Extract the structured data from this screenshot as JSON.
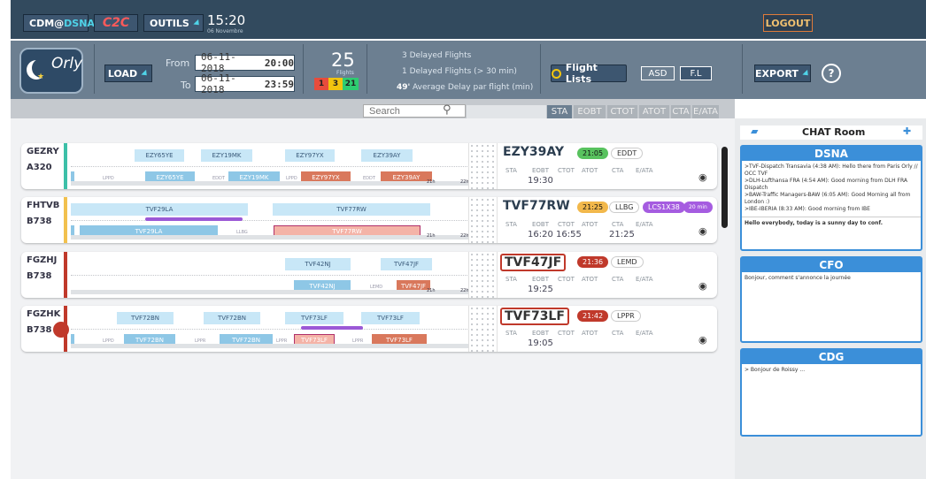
{
  "topbar": {
    "cdm_prefix": "CDM@",
    "cdm_highlight": "DSNA",
    "c2c": "C2C",
    "outils": "OUTILS",
    "time": "15:20",
    "date": "06 Novembre",
    "logout": "LOGOUT"
  },
  "logo": {
    "text": "Orly"
  },
  "controls": {
    "load": "LOAD",
    "from_label": "From",
    "from_date": "06-11-2018",
    "from_time": "20:00",
    "to_label": "To",
    "to_date": "06-11-2018",
    "to_time": "23:59",
    "flights_count": "25",
    "flights_label": "Flights",
    "badges": [
      "1",
      "3",
      "21"
    ],
    "delayed": "3 Delayed Flights",
    "delayed30": "1 Delayed Flights (> 30 min)",
    "avg_value": "49'",
    "avg_text": "Average Delay par flight (min)",
    "flight_lists": "Flight Lists",
    "asd": "ASD",
    "fl": "F.L",
    "export": "EXPORT",
    "help": "?"
  },
  "search": {
    "placeholder": "Search"
  },
  "columns": [
    "STA",
    "EOBT",
    "CTOT",
    "ATOT",
    "CTA",
    "E/ATA"
  ],
  "headers": {
    "sta": "STA",
    "eobt": "EOBT",
    "ctot": "CTOT",
    "atot": "ATOT",
    "cta": "CTA",
    "eata": "E/ATA"
  },
  "rows": [
    {
      "reg": "GEZRY",
      "ac": "A320",
      "band": "#3dc0a8",
      "flight": "EZY39AY",
      "time": "21:05",
      "time_color": "#58c25e",
      "dest": "EDDT",
      "extra": "",
      "extra2": "",
      "eobt": "19:30",
      "ctot": "",
      "cta": ""
    },
    {
      "reg": "FHTVB",
      "ac": "B738",
      "band": "#f2c14e",
      "flight": "TVF77RW",
      "time": "21:25",
      "time_color": "#f2b84b",
      "dest": "LLBG",
      "extra": "LCS1X38",
      "extra2": "20 min",
      "eobt": "16:20",
      "ctot": "16:55",
      "cta": "21:25"
    },
    {
      "reg": "FGZHJ",
      "ac": "B738",
      "band": "#c0392b",
      "flight": "TVF47JF",
      "time": "21:36",
      "time_color": "#c0392b",
      "dest": "LEMD",
      "extra": "",
      "extra2": "",
      "eobt": "19:25",
      "ctot": "",
      "cta": ""
    },
    {
      "reg": "FGZHK",
      "ac": "B738",
      "band": "#c0392b",
      "flight": "TVF73LF",
      "time": "21:42",
      "time_color": "#c0392b",
      "dest": "LPPR",
      "extra": "",
      "extra2": "",
      "eobt": "19:05",
      "ctot": "",
      "cta": ""
    }
  ],
  "segments": {
    "r0": [
      "EZY65YE",
      "EZY19MK",
      "EZY97YX",
      "EZY39AY"
    ],
    "r0b": [
      "EZY65YE",
      "EZY19MK",
      "EZY97YX",
      "EZY39AY"
    ],
    "r0small": [
      "LPPD",
      "EDDT",
      "LPPD",
      "EDDT"
    ],
    "r1": [
      "TVF29LA",
      "TVF77RW"
    ],
    "r1b": [
      "TVF29LA",
      "TVF77RW"
    ],
    "r1small": [
      "LLBG"
    ],
    "r2": [
      "TVF42NJ",
      "TVF47JF"
    ],
    "r2b": [
      "TVF42NJ",
      "TVF47JF"
    ],
    "r2small": [
      "LEMD"
    ],
    "r3": [
      "TVF72BN",
      "TVF72BN",
      "TVF73LF",
      "TVF73LF"
    ],
    "r3b": [
      "TVF72BN",
      "TVF72BN",
      "TVF73LF",
      "TVF73LF"
    ],
    "r3small": [
      "LPPD",
      "LPPR",
      "LPPR",
      "LPPR"
    ],
    "axis": [
      "21h",
      "22h"
    ]
  },
  "chat": {
    "title": "CHAT Room",
    "dsna": {
      "name": "DSNA",
      "messages": [
        ">TVF-Dispatch Transavia (4:38 AM): Hello there from Paris Orly // OCC TVF",
        ">DLH-Lufthansa FRA (4:54 AM): Good morning from DLH FRA Dispatch",
        ">BAW-Traffic Managers-BAW (6:05 AM): Good Morning all from London :)",
        ">IBE-IBERIA (8:33 AM): Good morning from IBE"
      ],
      "input": "Hello everybody, today is a sunny day to conf."
    },
    "cfo": {
      "name": "CFO",
      "message": "Bonjour, comment s'annonce la journée"
    },
    "cdg": {
      "name": "CDG",
      "message": "> Bonjour de Roissy ..."
    }
  },
  "colors": {
    "topbar": "#324a5e",
    "ctrlbar": "#6c7f91",
    "accent": "#4fd3e8",
    "chat_blue": "#3b8fd9"
  }
}
